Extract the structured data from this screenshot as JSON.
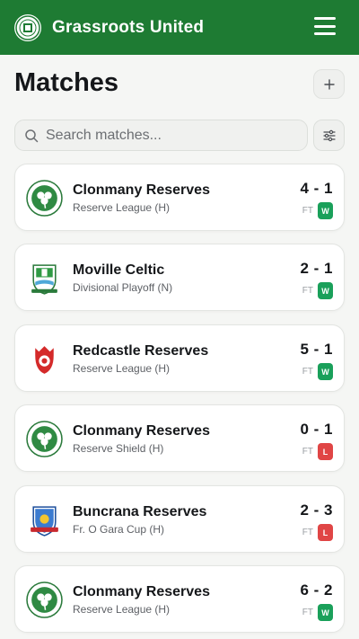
{
  "header": {
    "club_name": "Grassroots United",
    "logo_icon": "club-crest-icon",
    "menu_icon": "hamburger-menu-icon"
  },
  "page": {
    "title": "Matches",
    "add_icon": "plus-icon",
    "filter_icon": "sliders-icon"
  },
  "search": {
    "placeholder": "Search matches...",
    "value": "",
    "icon": "search-icon"
  },
  "colors": {
    "header": "#1e7b33",
    "win": "#1aa05a",
    "loss": "#e04545"
  },
  "matches": [
    {
      "opponent": "Clonmany Reserves",
      "competition": "Reserve League (H)",
      "score": "4 - 1",
      "status": "FT",
      "result": "W",
      "crest": "clonmany"
    },
    {
      "opponent": "Moville Celtic",
      "competition": "Divisional Playoff (N)",
      "score": "2 - 1",
      "status": "FT",
      "result": "W",
      "crest": "moville"
    },
    {
      "opponent": "Redcastle Reserves",
      "competition": "Reserve League (H)",
      "score": "5 - 1",
      "status": "FT",
      "result": "W",
      "crest": "redcastle"
    },
    {
      "opponent": "Clonmany Reserves",
      "competition": "Reserve Shield (H)",
      "score": "0 - 1",
      "status": "FT",
      "result": "L",
      "crest": "clonmany"
    },
    {
      "opponent": "Buncrana Reserves",
      "competition": "Fr. O Gara Cup (H)",
      "score": "2 - 3",
      "status": "FT",
      "result": "L",
      "crest": "buncrana"
    },
    {
      "opponent": "Clonmany Reserves",
      "competition": "Reserve League (H)",
      "score": "6 - 2",
      "status": "FT",
      "result": "W",
      "crest": "clonmany"
    }
  ]
}
